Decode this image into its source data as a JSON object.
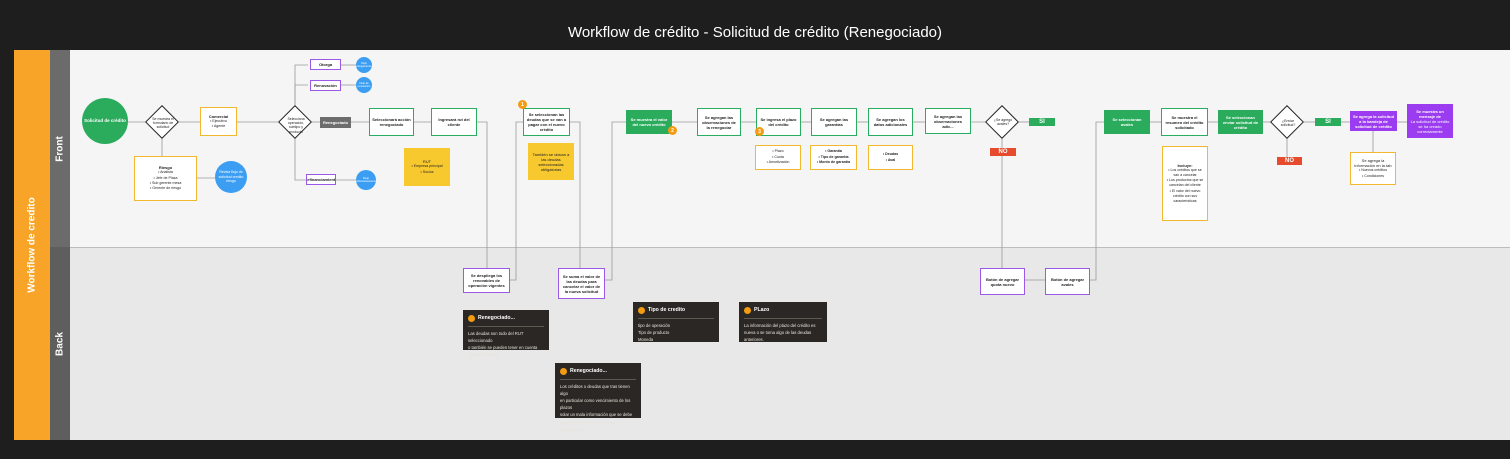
{
  "title": "Workflow de crédito - Solicitud de crédito (Renegociado)",
  "lanes": {
    "outer": "Workflow de credito",
    "front": "Front",
    "back": "Back"
  },
  "colors": {
    "green": "#2bac5d",
    "purple": "#9b3cf0",
    "yellow": "#f8c92f",
    "orange": "#f7a428",
    "blue": "#3b9ef3",
    "red": "#e54b2c"
  },
  "front": {
    "start": "Solicitud de crédito",
    "dec1": "Se muestra el formulario de solicitud",
    "riesgo": {
      "title": "Riesgo",
      "items": [
        "Analista",
        "Jefe de Plaza",
        "Sub gerente mesa",
        "Gerente de riesgo"
      ]
    },
    "riesgo_end": "Revisa flujo de solicitud credito riesgo",
    "comercial": {
      "title": "Comercial",
      "items": [
        "Ejecutivo",
        "Agente"
      ]
    },
    "dec2": "Selecciona operación, subtipo y producto",
    "otorga": "Otorga",
    "otorga_end": "Flujo otorgamiento",
    "renovacion": "Renovación",
    "renovacion_end": "Flujo de renovacion",
    "renegociado": "Renegociado",
    "refinanciamiento": "Refinanciamiento",
    "refin_end": "Flujo refinanciamiento",
    "selecciona_accion": "Seleccionará acción renegociado",
    "ingresa_rut": "Ingresará rut del cliente",
    "rut_note": {
      "title": "RUT",
      "items": [
        "Empresa principal",
        "Socios"
      ]
    },
    "selecciona_deudas": "Se seleccionan las deudas que se van a pagar con el nuevo crédito",
    "deudas_note": "También se ubican a las deudas seleccionadas obligatorias",
    "muestra_valor": "Se muestra el valor del nuevo crédito",
    "agregan_obs": "Se agregan las observaciones de la renegociar",
    "ingresa_plazo": "Se ingresa el plazo del crédito",
    "plazo_items": [
      "Plazo",
      "Cuota",
      "Amortización"
    ],
    "agregan_garantias": "Se agregan las garantías",
    "garantias_items": [
      "Garantía",
      "Tipo de garantía",
      "Monto de garantía"
    ],
    "agregan_datos": "Se agregan los datos adicionales",
    "datos_items": [
      "Deudas",
      "Aval"
    ],
    "agregan_obs_adic": "Se agregan las observaciones adic...",
    "dec3": "¿Se agregó avales?",
    "si1": "SI",
    "no1": "NO",
    "selecciona_avales": "Se seleccionan avales",
    "muestra_resumen": "Se muestra el resumen del crédito solicitado",
    "incluye": {
      "title": "Incluye:",
      "items": [
        "Los créditos que se van a cancelar",
        "Los productos que se cancelan del cliente",
        "El valor del nuevo crédito con sus características"
      ]
    },
    "envia_solicitud": "Se seleccionan enviar solicitud de crédito",
    "dec4": "¿Enviar solicitud?",
    "si2": "SI",
    "no2": "NO",
    "agrega_solicitud": "Se agrega la solicitud a la bandeja de solicitud de crédito",
    "agrega_items": {
      "title": "Se agrega la información en la tab",
      "items": [
        "Nuevos créditos",
        "Condiciones"
      ]
    },
    "final": {
      "title": "Se muestra un mensaje de",
      "text": "La solicitud de crédito se ha creado correctamente"
    }
  },
  "back": {
    "despliega": "Se despliega los renovables de operación vigentes",
    "suma": "Se suma el valor de las deudas para cancelar el valor de la nueva solicitud",
    "boton_quita": "Botón de agregar quota nuevo",
    "boton_avales": "Botón de agregar avales"
  },
  "notes": [
    {
      "title": "Renegociado...",
      "lines": [
        "Las deudas son todo del RUT seleccionado",
        "o también se pueden tener en cuenta",
        "deudas del grupo."
      ]
    },
    {
      "title": "Tipo de credito",
      "lines": [
        "tipo de operación",
        "Tipo de producto",
        "Moneda"
      ]
    },
    {
      "title": "PLazo",
      "lines": [
        "La información del plazo del crédito es",
        "nueva o se toma algo de las deudas",
        "anteriores."
      ]
    },
    {
      "title": "Renegociado...",
      "lines": [
        "Los créditos o deudas que tras tienen algo",
        "en particular como vencimiento de los plazos",
        "solar un mala información que se debe",
        "recalcar al momento de hacer el",
        "renegociado."
      ]
    }
  ],
  "markers": [
    "1",
    "2",
    "3"
  ]
}
